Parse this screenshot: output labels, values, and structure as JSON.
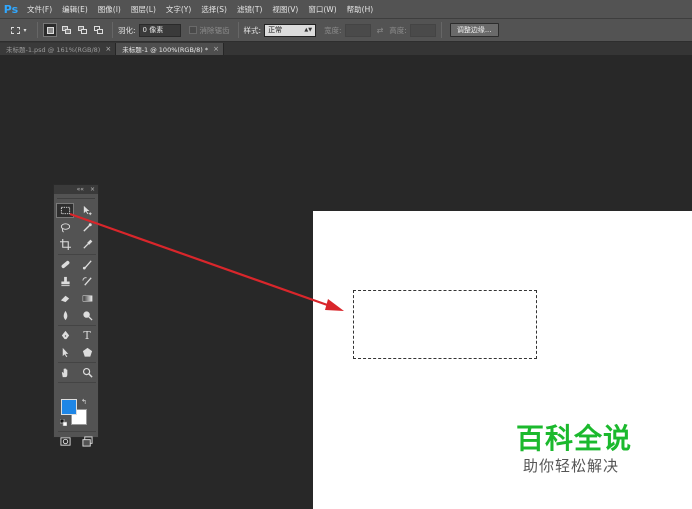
{
  "app": {
    "logo": "Ps"
  },
  "menu": [
    "文件(F)",
    "编辑(E)",
    "图像(I)",
    "图层(L)",
    "文字(Y)",
    "选择(S)",
    "滤镜(T)",
    "视图(V)",
    "窗口(W)",
    "帮助(H)"
  ],
  "options": {
    "feather_label": "羽化:",
    "feather_value": "0 像素",
    "antialias_label": "消除锯齿",
    "style_label": "样式:",
    "style_value": "正常",
    "width_label": "宽度:",
    "height_label": "高度:",
    "refine_edge": "调整边缘..."
  },
  "tabs": [
    {
      "label": "未标题-1.psd @ 161%(RGB/8)",
      "close": "×",
      "active": false
    },
    {
      "label": "未标题-1 @ 100%(RGB/8) *",
      "close": "×",
      "active": true
    }
  ],
  "toolbox": {
    "header_collapse": "««",
    "header_close": "×",
    "foreground_color": "#1e86e6",
    "background_color": "#ffffff",
    "type_tool_glyph": "T"
  },
  "icons": {
    "marquee": "rect-marquee-icon",
    "move": "move-icon",
    "lasso": "lasso-icon",
    "quick_select": "quick-select-icon",
    "crop": "crop-icon",
    "eyedropper": "eyedropper-icon",
    "healing": "spot-healing-icon",
    "brush": "brush-icon",
    "stamp": "clone-stamp-icon",
    "history_brush": "history-brush-icon",
    "eraser": "eraser-icon",
    "gradient": "gradient-icon",
    "blur": "blur-icon",
    "dodge": "dodge-icon",
    "pen": "pen-icon",
    "type": "type-icon",
    "path_select": "path-selection-icon",
    "shape": "shape-icon",
    "hand": "hand-icon",
    "zoom": "zoom-icon",
    "quickmask": "quick-mask-icon",
    "screenmode": "screen-mode-icon"
  },
  "watermark": {
    "title": "百科全说",
    "subtitle": "助你轻松解决"
  },
  "colors": {
    "arrow": "#d9262b",
    "watermark": "#1bb92d",
    "ps_blue": "#31a8ff"
  }
}
